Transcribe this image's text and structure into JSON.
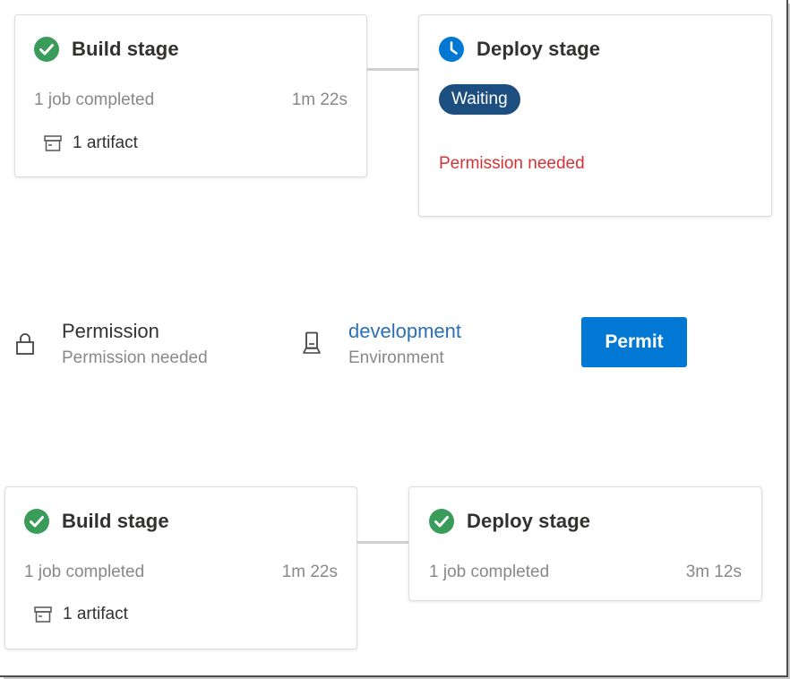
{
  "top_pipeline": {
    "build": {
      "title": "Build stage",
      "status": "succeeded",
      "jobs": "1 job completed",
      "duration": "1m 22s",
      "artifacts": "1 artifact"
    },
    "deploy": {
      "title": "Deploy stage",
      "status": "waiting",
      "badge": "Waiting",
      "message": "Permission needed"
    }
  },
  "approval": {
    "permission_title": "Permission",
    "permission_subtitle": "Permission needed",
    "environment_name": "development",
    "environment_label": "Environment",
    "permit_label": "Permit"
  },
  "bottom_pipeline": {
    "build": {
      "title": "Build stage",
      "status": "succeeded",
      "jobs": "1 job completed",
      "duration": "1m 22s",
      "artifacts": "1 artifact"
    },
    "deploy": {
      "title": "Deploy stage",
      "status": "succeeded",
      "jobs": "1 job completed",
      "duration": "3m 12s"
    }
  },
  "colors": {
    "success": "#2e8b57",
    "waiting_icon": "#0078d4",
    "badge": "#1c4e80",
    "error_text": "#d13438",
    "link": "#2b6fb6",
    "primary_button": "#0078d4"
  },
  "icons": {
    "success": "check-circle-icon",
    "waiting": "clock-icon",
    "artifact": "artifact-icon",
    "permission": "lock-icon",
    "environment": "environment-icon"
  }
}
